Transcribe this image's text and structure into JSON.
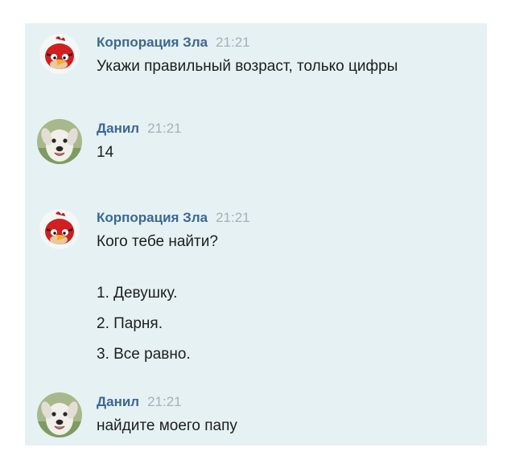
{
  "messages": [
    {
      "author": "Корпорация Зла",
      "time": "21:21",
      "avatar_icon": "red-angry-bird-icon",
      "text": "Укажи правильный возраст, только цифры"
    },
    {
      "author": "Данил",
      "time": "21:21",
      "avatar_icon": "white-dog-icon",
      "text": "14"
    },
    {
      "author": "Корпорация Зла",
      "time": "21:21",
      "avatar_icon": "red-angry-bird-icon",
      "text": "Кого тебе найти?",
      "options": [
        "1. Девушку.",
        "2. Парня.",
        "3. Все равно."
      ]
    },
    {
      "author": "Данил",
      "time": "21:21",
      "avatar_icon": "white-dog-icon",
      "text": "найдите моего папу"
    }
  ],
  "colors": {
    "chat_background": "#e5f1f3",
    "author_name": "#3c6795",
    "timestamp": "#a6b0bb",
    "message_text": "#1e1e1e"
  }
}
